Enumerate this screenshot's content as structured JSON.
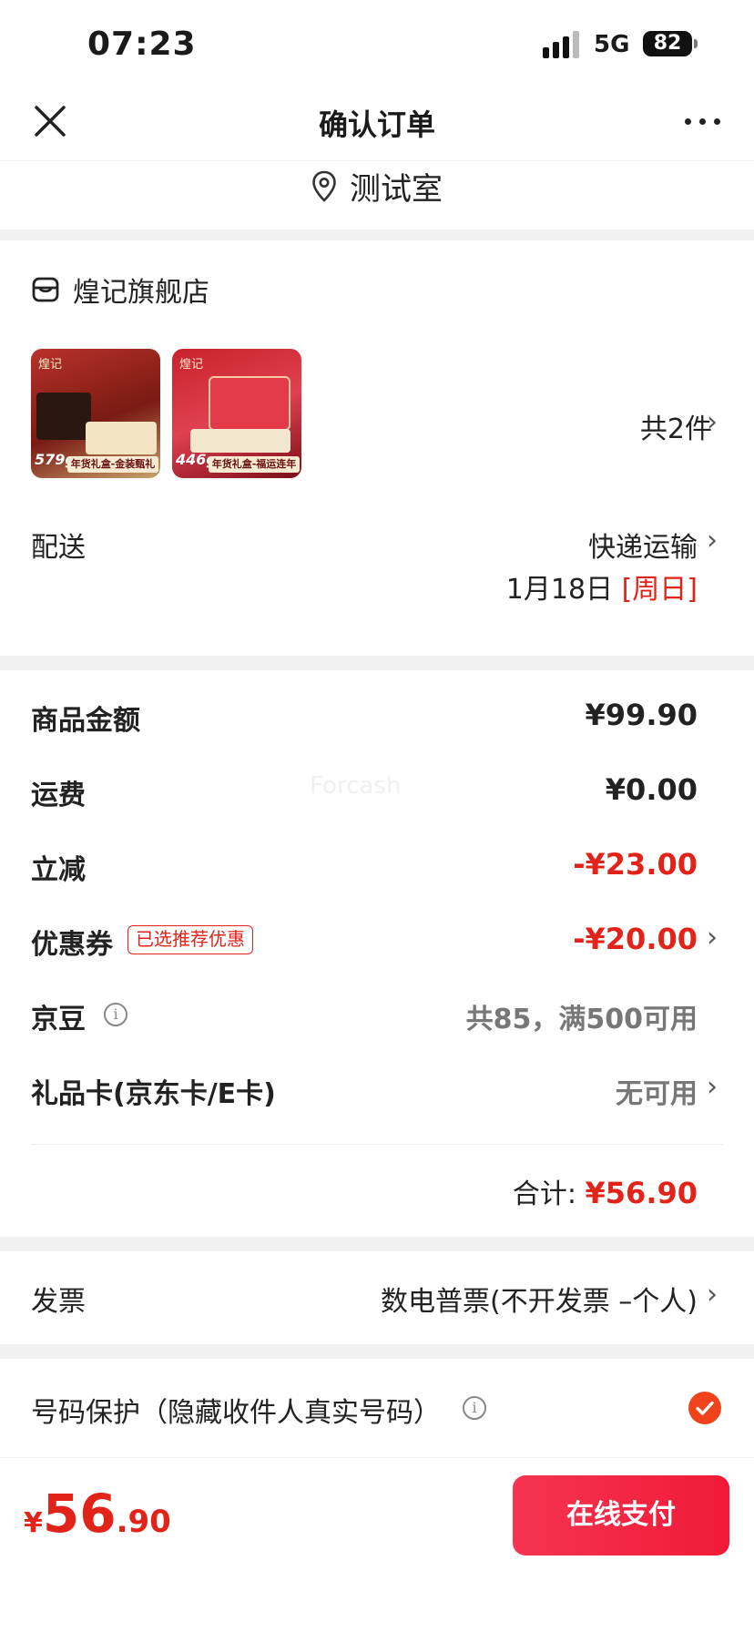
{
  "status_bar": {
    "time": "07:23",
    "network": "5G",
    "battery": "82"
  },
  "nav": {
    "title": "确认订单"
  },
  "address": {
    "name": "测试室"
  },
  "shop": {
    "name": "煌记旗舰店",
    "products": [
      {
        "brand": "煌记",
        "weight": "579g",
        "caption": "年货礼盒-金装甄礼"
      },
      {
        "brand": "煌记",
        "weight": "446g",
        "caption": "年货礼盒-福运连年"
      }
    ],
    "count_label": "共2件"
  },
  "delivery": {
    "label": "配送",
    "method": "快递运输",
    "date": "1月18日",
    "weekday": "[周日]"
  },
  "summary": {
    "goods_label": "商品金额",
    "goods_value": "¥99.90",
    "shipping_label": "运费",
    "shipping_value": "¥0.00",
    "discount_label": "立减",
    "discount_value": "-¥23.00",
    "coupon_label": "优惠券",
    "coupon_badge": "已选推荐优惠",
    "coupon_value": "-¥20.00",
    "beans_label": "京豆",
    "beans_value": "共85，满500可用",
    "giftcard_label": "礼品卡(京东卡/E卡)",
    "giftcard_value": "无可用",
    "total_label": "合计:",
    "total_value": "¥56.90"
  },
  "invoice": {
    "label": "发票",
    "value": "数电普票(不开发票 –个人)"
  },
  "privacy": {
    "label": "号码保护（隐藏收件人真实号码）",
    "checked": true
  },
  "bottom": {
    "currency": "¥",
    "price_int": "56",
    "price_dec": ".90",
    "pay_label": "在线支付"
  },
  "watermark": "Forcash",
  "colors": {
    "accent_red": "#e2231a",
    "pay_button": "#f01a38",
    "check_orange": "#f0421b"
  }
}
